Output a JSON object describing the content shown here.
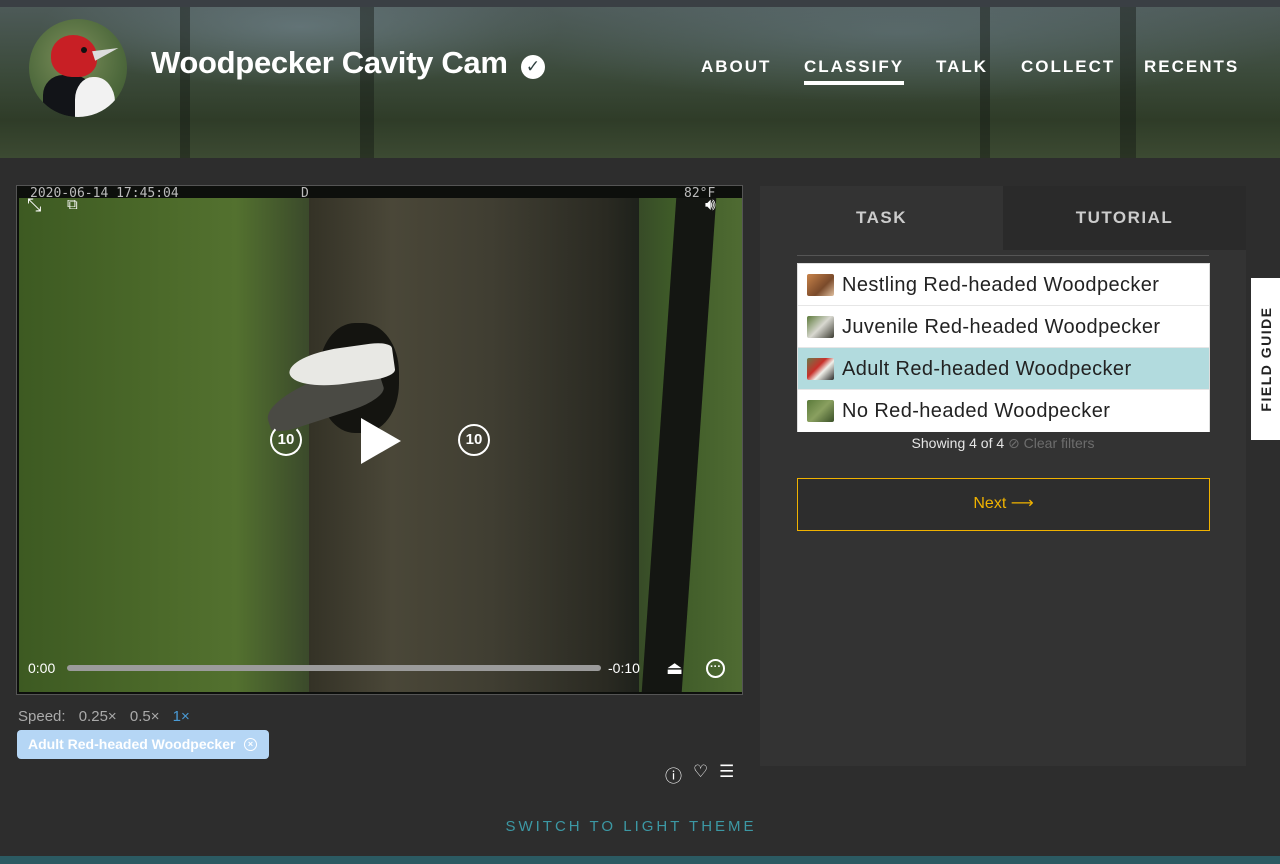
{
  "project": {
    "title": "Woodpecker Cavity Cam",
    "verified_icon": "check-circle-icon"
  },
  "nav": {
    "items": [
      {
        "label": "ABOUT",
        "active": false
      },
      {
        "label": "CLASSIFY",
        "active": true
      },
      {
        "label": "TALK",
        "active": false
      },
      {
        "label": "COLLECT",
        "active": false
      },
      {
        "label": "RECENTS",
        "active": false
      }
    ]
  },
  "video": {
    "timestamp_overlay": "2020-06-14 17:45:04",
    "overlay_flag": "D",
    "temperature_overlay": "82°F",
    "skip_back_label": "10",
    "skip_forward_label": "10",
    "current_time": "0:00",
    "remaining_time": "-0:10",
    "progress": 0
  },
  "speed": {
    "label": "Speed:",
    "options": [
      "0.25×",
      "0.5×",
      "1×"
    ],
    "selected": "1×"
  },
  "selected_tag": {
    "label": "Adult Red-headed Woodpecker"
  },
  "panel": {
    "tabs": [
      "TASK",
      "TUTORIAL"
    ],
    "active_tab": "TASK",
    "options": [
      {
        "label": "Nestling Red-headed Woodpecker",
        "selected": false
      },
      {
        "label": "Juvenile Red-headed Woodpecker",
        "selected": false
      },
      {
        "label": "Adult Red-headed Woodpecker",
        "selected": true
      },
      {
        "label": "No Red-headed Woodpecker",
        "selected": false
      }
    ],
    "showing_text": "Showing 4 of 4",
    "clear_filters": "Clear filters",
    "next_label": "Next ⟶"
  },
  "field_guide": {
    "label": "FIELD GUIDE"
  },
  "footer": {
    "switch_theme": "SWITCH TO LIGHT THEME"
  },
  "colors": {
    "accent_gold": "#f0b200",
    "selected_option": "#b2dbde",
    "link_teal": "#3c98a4",
    "speed_selected": "#4a9bd6",
    "tag_bg": "#b5d6f5"
  }
}
